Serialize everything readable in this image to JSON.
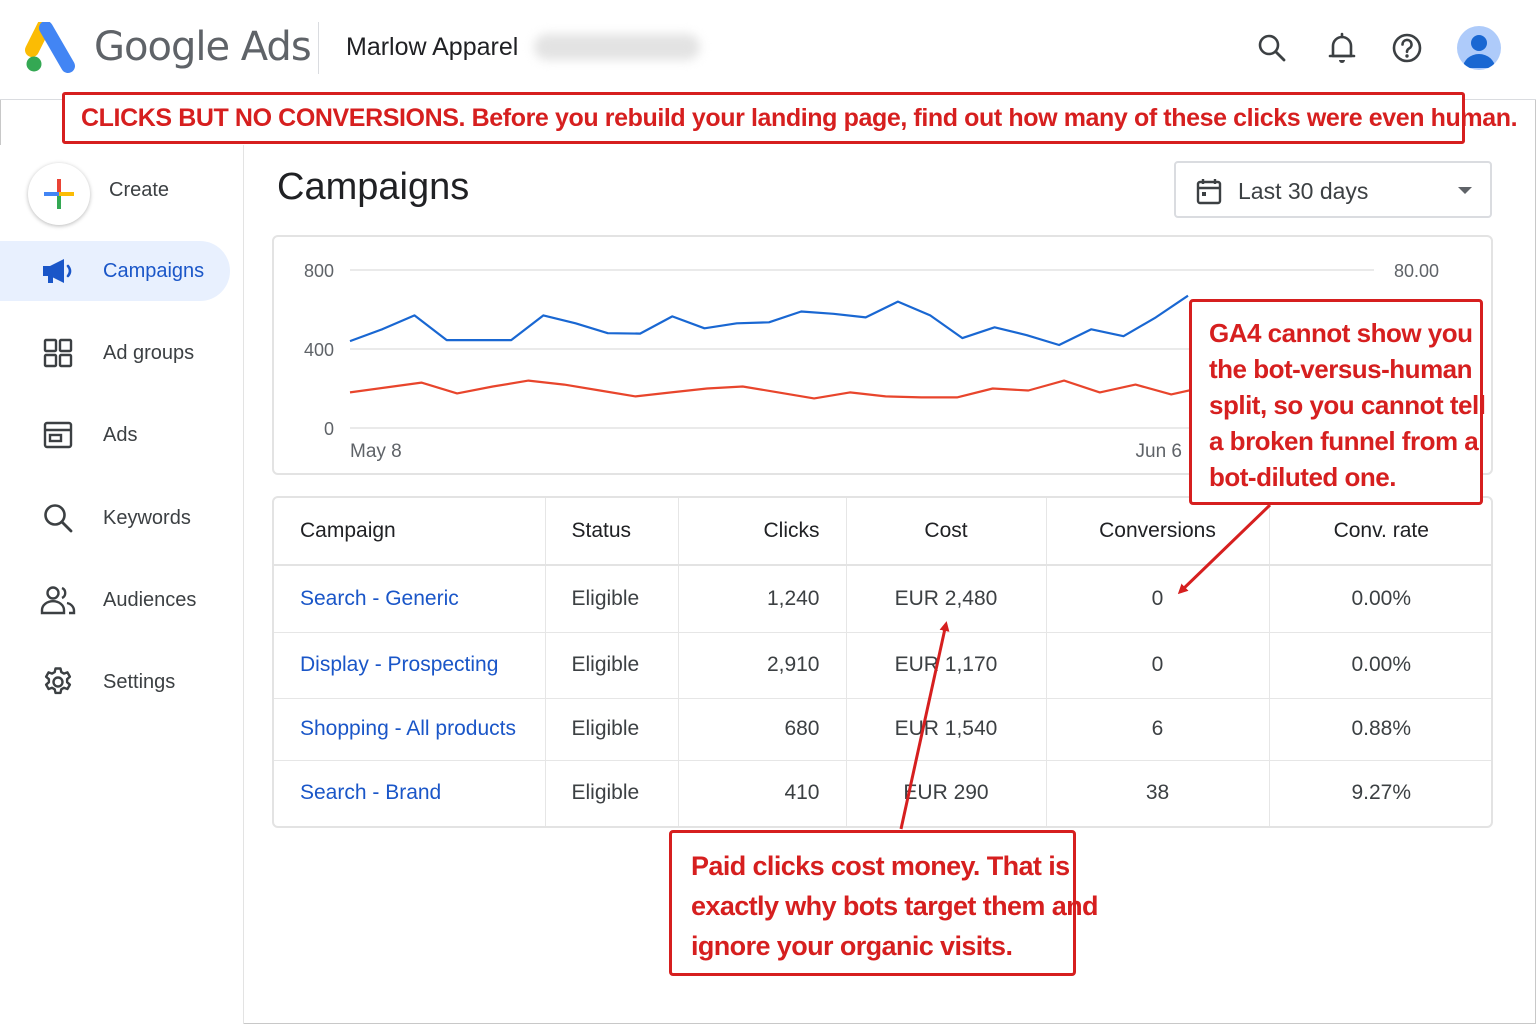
{
  "header": {
    "brand": "Google Ads",
    "account_name": "Marlow Apparel",
    "icons": [
      "search-icon",
      "bell-icon",
      "help-icon",
      "account-avatar-icon"
    ]
  },
  "banner": {
    "text": "CLICKS BUT NO CONVERSIONS. Before you rebuild your landing  page, find out how many of these clicks were even human."
  },
  "sidebar": {
    "create_label": "Create",
    "items": [
      {
        "label": "Campaigns",
        "icon": "megaphone-icon",
        "active": true
      },
      {
        "label": "Ad groups",
        "icon": "grid-icon",
        "active": false
      },
      {
        "label": "Ads",
        "icon": "ad-card-icon",
        "active": false
      },
      {
        "label": "Keywords",
        "icon": "search-icon",
        "active": false
      },
      {
        "label": "Audiences",
        "icon": "people-icon",
        "active": false
      },
      {
        "label": "Settings",
        "icon": "gear-icon",
        "active": false
      }
    ]
  },
  "main": {
    "title": "Campaigns",
    "date_range": "Last 30 days"
  },
  "chart_data": {
    "type": "line",
    "y_left_ticks": [
      "800",
      "400",
      "0"
    ],
    "y_right_ticks": [
      "80.00"
    ],
    "x_tick_labels": [
      "May 8",
      "Jun 6"
    ],
    "ylim": [
      0,
      800
    ],
    "grid": true,
    "series": [
      {
        "color": "#1967d2",
        "values": [
          440,
          500,
          570,
          445,
          445,
          445,
          570,
          530,
          480,
          478,
          565,
          505,
          530,
          535,
          590,
          578,
          560,
          640,
          570,
          455,
          510,
          470,
          420,
          500,
          465,
          560,
          670
        ]
      },
      {
        "color": "#e8452c",
        "values": [
          180,
          205,
          230,
          175,
          210,
          240,
          220,
          190,
          160,
          180,
          200,
          210,
          180,
          150,
          180,
          160,
          155,
          155,
          200,
          190,
          240,
          180,
          220,
          170,
          210,
          180,
          200,
          220
        ]
      }
    ]
  },
  "table": {
    "columns": [
      "Campaign",
      "Status",
      "Clicks",
      "Cost",
      "Conversions",
      "Conv. rate"
    ],
    "rows": [
      {
        "campaign": "Search - Generic",
        "status": "Eligible",
        "clicks": "1,240",
        "cost": "EUR 2,480",
        "conversions": "0",
        "conv_rate": "0.00%"
      },
      {
        "campaign": "Display - Prospecting",
        "status": "Eligible",
        "clicks": "2,910",
        "cost": "EUR 1,170",
        "conversions": "0",
        "conv_rate": "0.00%"
      },
      {
        "campaign": "Shopping - All products",
        "status": "Eligible",
        "clicks": "680",
        "cost": "EUR 1,540",
        "conversions": "6",
        "conv_rate": "0.88%"
      },
      {
        "campaign": "Search - Brand",
        "status": "Eligible",
        "clicks": "410",
        "cost": "EUR 290",
        "conversions": "38",
        "conv_rate": "9.27%"
      }
    ]
  },
  "callouts": {
    "ga4": [
      "GA4 cannot show you",
      "the bot-versus-human",
      "split, so you cannot tell",
      "a broken funnel from a",
      "bot-diluted one."
    ],
    "paid": [
      "Paid clicks cost money. That is",
      "exactly why bots target them and",
      "ignore your organic visits."
    ]
  },
  "colors": {
    "accent_blue": "#1a56c8",
    "annotation_red": "#d61f1f",
    "series_blue": "#1967d2",
    "series_red": "#e8452c"
  }
}
